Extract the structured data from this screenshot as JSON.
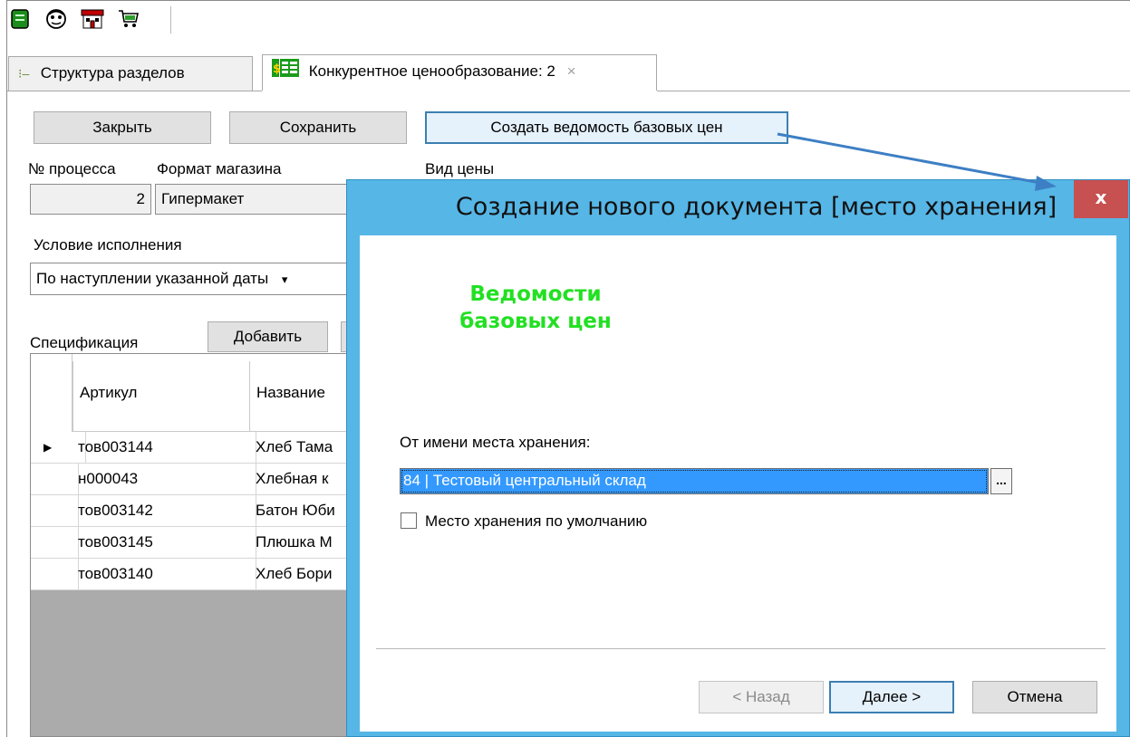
{
  "toolbar": {
    "icons": [
      "document-icon",
      "face-icon",
      "store-icon",
      "cart-icon"
    ]
  },
  "tabs": [
    {
      "label": "Структура разделов"
    },
    {
      "label": "Конкурентное ценообразование: 2",
      "close": "×"
    }
  ],
  "actions": {
    "close_label": "Закрыть",
    "save_label": "Сохранить",
    "create_label": "Создать ведомость базовых цен"
  },
  "form": {
    "process_no_label": "№ процесса",
    "process_no_value": "2",
    "store_format_label": "Формат магазина",
    "store_format_value": "Гипермакет",
    "price_type_label": "Вид цены",
    "condition_label": "Условие исполнения",
    "condition_value": "По наступлении указанной даты"
  },
  "spec": {
    "label": "Спецификация",
    "add_label": "Добавить",
    "columns": [
      "Артикул",
      "Название"
    ],
    "rows": [
      {
        "marker": "▶",
        "article": "тов003144",
        "name": "Хлеб Тама"
      },
      {
        "marker": "",
        "article": "н000043",
        "name": "Хлебная к"
      },
      {
        "marker": "",
        "article": "тов003142",
        "name": "Батон Юби"
      },
      {
        "marker": "",
        "article": "тов003145",
        "name": "Плюшка М"
      },
      {
        "marker": "",
        "article": "тов003140",
        "name": "Хлеб Бори"
      }
    ]
  },
  "dialog": {
    "title": "Создание нового документа [место хранения]",
    "close_glyph": "x",
    "heading_line1": "Ведомости",
    "heading_line2": "базовых цен",
    "storage_label": "От имени места хранения:",
    "storage_value": "84 | Тестовый центральный склад",
    "ellipsis": "...",
    "default_checkbox_label": "Место хранения по умолчанию",
    "back_label": "< Назад",
    "next_label": "Далее >",
    "cancel_label": "Отмена"
  },
  "colors": {
    "dialog_frame": "#56b6e6",
    "close_button": "#c75050",
    "heading_green": "#22e022",
    "selection": "#3399ff",
    "arrow": "#3d7fc4"
  }
}
